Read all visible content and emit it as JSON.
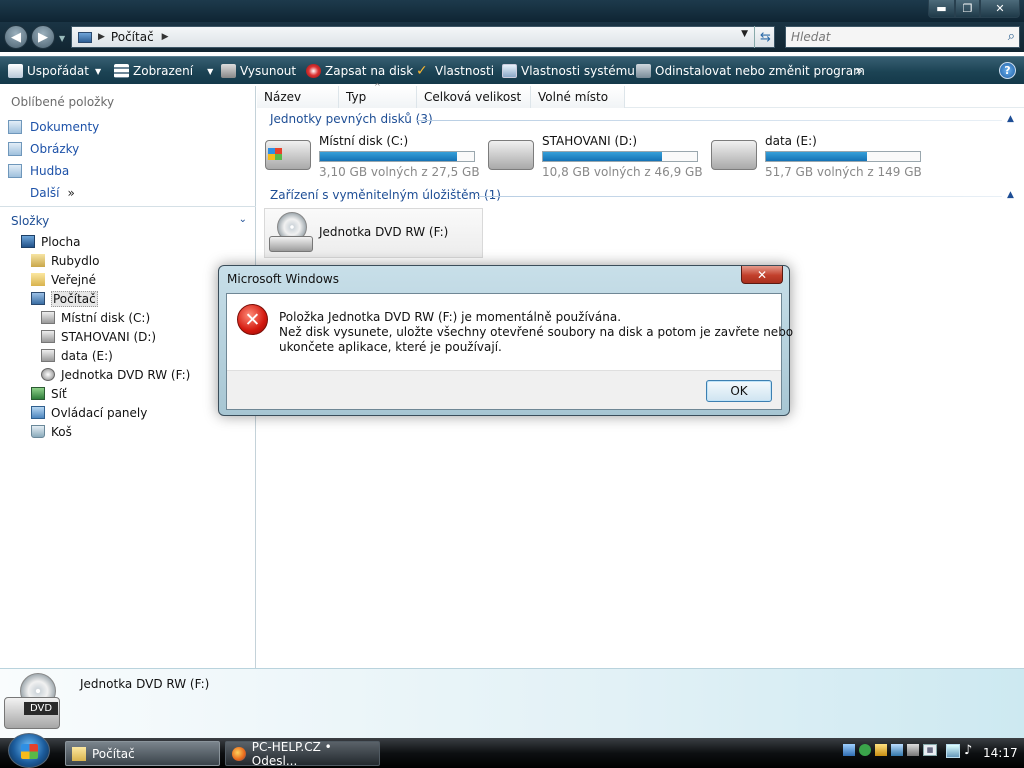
{
  "window": {
    "minimize": "▬",
    "maximize": "❐",
    "close": "✕"
  },
  "address": {
    "path": "Počítač",
    "search_placeholder": "Hledat"
  },
  "toolbar": {
    "organize": "Uspořádat",
    "views": "Zobrazení",
    "eject": "Vysunout",
    "burn": "Zapsat na disk",
    "properties": "Vlastnosti",
    "system_properties": "Vlastnosti systému",
    "uninstall": "Odinstalovat nebo změnit program",
    "more": "»"
  },
  "sidebar": {
    "favorites_title": "Oblíbené položky",
    "favorites": [
      {
        "label": "Dokumenty"
      },
      {
        "label": "Obrázky"
      },
      {
        "label": "Hudba"
      }
    ],
    "more_label": "Další",
    "more_arrows": "»",
    "folders_title": "Složky",
    "tree": [
      {
        "label": "Plocha"
      },
      {
        "label": "Rubydlo"
      },
      {
        "label": "Veřejné"
      },
      {
        "label": "Počítač"
      },
      {
        "label": "Místní disk (C:)"
      },
      {
        "label": "STAHOVANI (D:)"
      },
      {
        "label": "data (E:)"
      },
      {
        "label": "Jednotka DVD RW (F:)"
      },
      {
        "label": "Síť"
      },
      {
        "label": "Ovládací panely"
      },
      {
        "label": "Koš"
      }
    ]
  },
  "columns": [
    "Název",
    "Typ",
    "Celková velikost",
    "Volné místo"
  ],
  "groups": {
    "hard_disks": "Jednotky pevných disků (3)",
    "removable": "Zařízení s vyměnitelným úložištěm (1)"
  },
  "drives": [
    {
      "name": "Místní disk (C:)",
      "free": "3,10 GB volných z 27,5 GB",
      "used_fraction": 0.887
    },
    {
      "name": "STAHOVANI (D:)",
      "free": "10,8 GB volných z 46,9 GB",
      "used_fraction": 0.77
    },
    {
      "name": "data (E:)",
      "free": "51,7 GB volných z 149 GB",
      "used_fraction": 0.653
    }
  ],
  "dvd": {
    "name": "Jednotka DVD RW (F:)",
    "badge": "DVD"
  },
  "details": {
    "name": "Jednotka DVD RW (F:)"
  },
  "dialog": {
    "title": "Microsoft Windows",
    "close": "✕",
    "line1": "Položka Jednotka DVD RW (F:) je momentálně používána.",
    "line2": "Než disk vysunete, uložte všechny otevřené soubory na disk a potom je zavřete nebo",
    "line3": "ukončete aplikace, které je používají.",
    "ok": "OK"
  },
  "taskbar": {
    "task1": "Počítač",
    "task2": "PC-HELP.CZ • Odesl...",
    "clock": "14:17"
  }
}
